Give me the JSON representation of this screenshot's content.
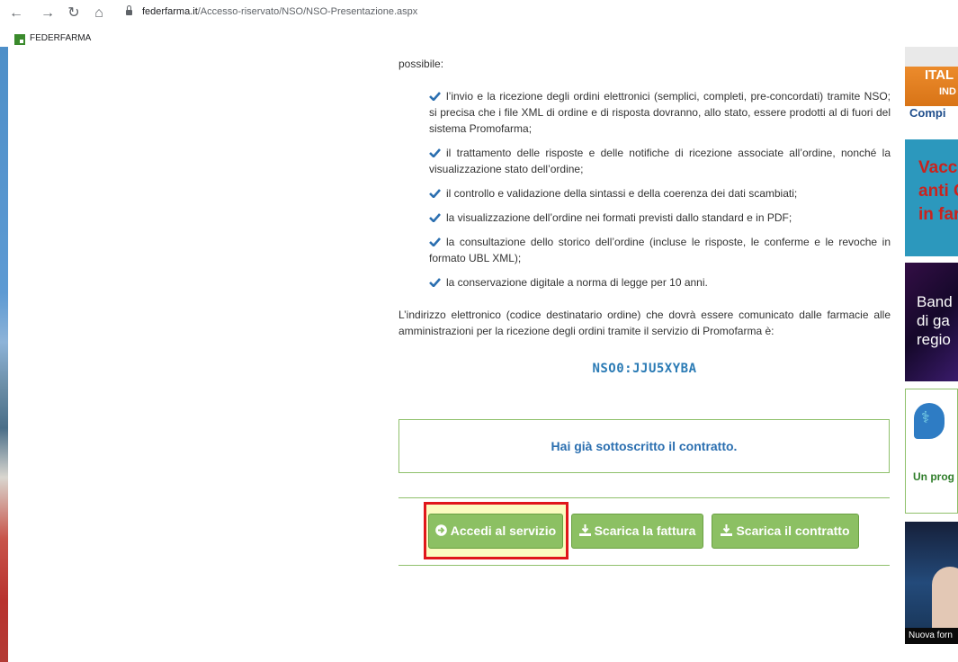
{
  "browser": {
    "nav_icons": [
      "back-icon",
      "forward-icon",
      "reload-icon",
      "home-icon"
    ],
    "url_host": "federfarma.it",
    "url_path": "/Accesso-riservato/NSO/NSO-Presentazione.aspx",
    "bookmark_label": "FEDERFARMA"
  },
  "content": {
    "intro": "possibile:",
    "bullets": [
      "l’invio e la ricezione degli ordini elettronici (semplici, completi, pre-concordati) tramite NSO; si precisa che i file XML di ordine e di risposta dovranno, allo stato, essere prodotti al di fuori del sistema Promofarma;",
      "il trattamento delle risposte e delle notifiche di ricezione associate all’ordine, nonché la visualizzazione stato dell’ordine;",
      "il controllo e validazione della sintassi e della coerenza dei dati scambiati;",
      "la visualizzazione dell’ordine nei formati previsti dallo standard e in PDF;",
      "la consultazione dello storico dell’ordine (incluse le risposte, le conferme e le revoche in formato UBL XML);",
      "la conservazione digitale a norma di legge per 10 anni."
    ],
    "address_paragraph": "L’indirizzo elettronico (codice destinatario ordine) che dovrà essere comunicato dalle farmacie alle amministrazioni per la ricezione degli ordini tramite il servizio di Promofarma è:",
    "nso_code": "NSO0:JJU5XYBA",
    "notice": "Hai già sottoscritto il contratto.",
    "buttons": {
      "access": "Accedi al servizio",
      "invoice": "Scarica la fattura",
      "contract": "Scarica il contratto"
    }
  },
  "ads": {
    "ad1": [
      "ITAL",
      "IND",
      "Compi"
    ],
    "ad2": [
      "Vacc",
      "anti C",
      "in far"
    ],
    "ad3": [
      "Band",
      "di ga",
      "regio"
    ],
    "ad4": "Un prog",
    "ad5": "Nuova forn"
  },
  "colors": {
    "accent_green": "#8cc063",
    "link_blue": "#2b6fb0",
    "highlight_red": "#e0161b"
  }
}
